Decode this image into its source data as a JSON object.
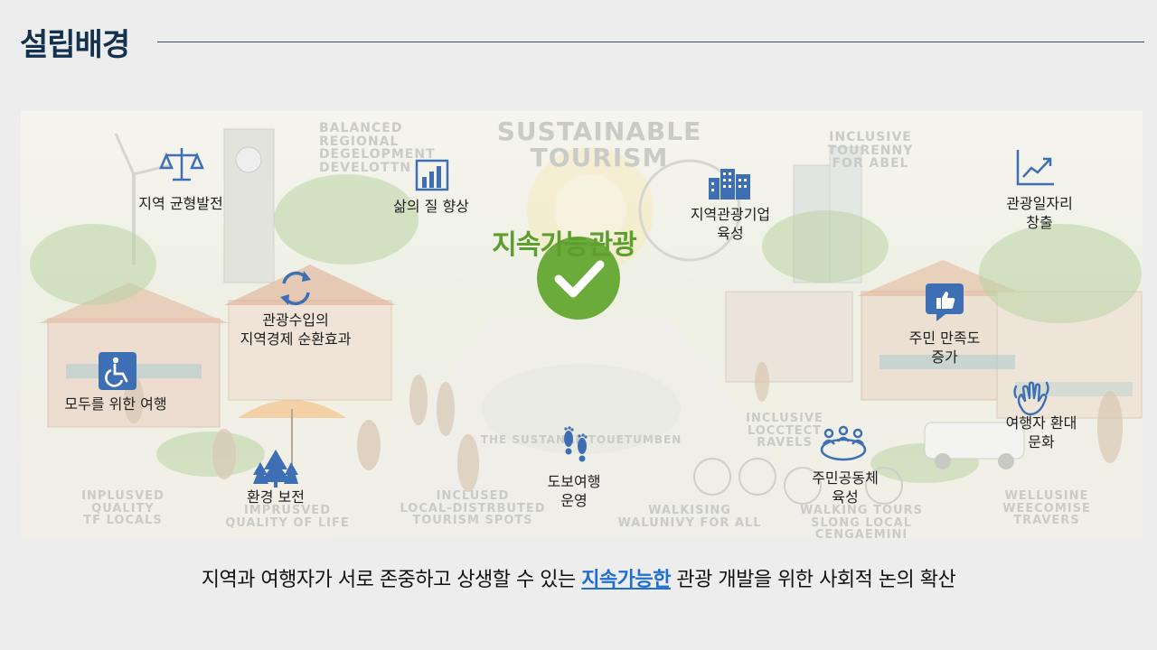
{
  "header": {
    "title": "설립배경"
  },
  "scene": {
    "sign_top_center": "SUSTAINABLE\nTOURISM",
    "sign_top_left": "BALANCED\nREGIONAL\nDEGELOPMENT\nDEVELOTTN",
    "sign_top_right": "INCLUSIVE\nTOURENNY\nFOR ABEL",
    "sign_bottom_1": "INPLUSVED\nQUALITY\nTF LOCALS",
    "sign_bottom_2": "IMPRUSVED\nQUALITY OF LIFE",
    "sign_bottom_3": "INCLUSED\nLOCAL-DISTRBUTED\nTOURISM SPOTS",
    "sign_bottom_4": "WALKISING\nWALUNIVY FOR ALL",
    "sign_bottom_5": "WALKING TOURS\nSLONG LOCAL CENGAEMINI",
    "sign_bottom_6": "WELLUSINE\nWEECOMISE\nTRAVERS",
    "sign_mid_right": "INCLUSIVE\nLOCCTECT\nRAVELS",
    "sign_plaza": "THE SUSTANAE TOUETUMBEN"
  },
  "center": {
    "label": "지속가능관광"
  },
  "items": {
    "regional_balance": "지역 균형발전",
    "quality_of_life": "삶의 질 향상",
    "local_business": "지역관광기업\n육성",
    "jobs": "관광일자리\n창출",
    "revenue_cycle": "관광수입의\n지역경제 순환효과",
    "resident_satisfaction": "주민 만족도\n증가",
    "accessible_travel": "모두를 위한 여행",
    "welcome_culture": "여행자 환대\n문화",
    "environment": "환경 보전",
    "walking_tours": "도보여행\n운영",
    "community": "주민공동체\n육성"
  },
  "caption": {
    "before": "지역과 여행자가 서로 존중하고 상생할 수 있는 ",
    "highlight": "지속가능한",
    "after": " 관광 개발을 위한 사회적 논의 확산"
  },
  "colors": {
    "title": "#14324f",
    "icon_blue": "#3e6fb5",
    "check_green": "#6aab3a",
    "center_label": "#5e9e2f",
    "highlight": "#1f6fd0"
  }
}
